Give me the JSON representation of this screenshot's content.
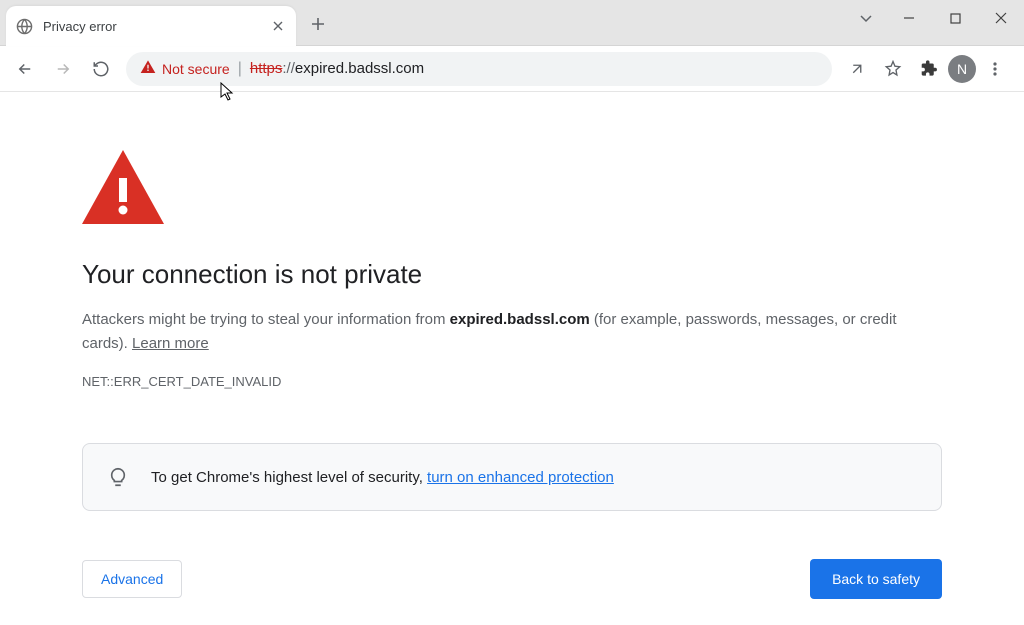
{
  "tab": {
    "title": "Privacy error"
  },
  "omnibox": {
    "security_label": "Not secure",
    "url_scheme_strike": "https",
    "url_sep": "://",
    "url_rest": "expired.badssl.com"
  },
  "avatar": {
    "initial": "N"
  },
  "interstitial": {
    "headline": "Your connection is not private",
    "body_pre": "Attackers might be trying to steal your information from ",
    "body_domain": "expired.badssl.com",
    "body_post": " (for example, passwords, messages, or credit cards). ",
    "learn_more": "Learn more",
    "error_code": "NET::ERR_CERT_DATE_INVALID",
    "info_pre": "To get Chrome's highest level of security, ",
    "info_link": "turn on enhanced protection",
    "advanced_label": "Advanced",
    "back_label": "Back to safety"
  },
  "colors": {
    "danger": "#d93025",
    "primary": "#1a73e8"
  }
}
